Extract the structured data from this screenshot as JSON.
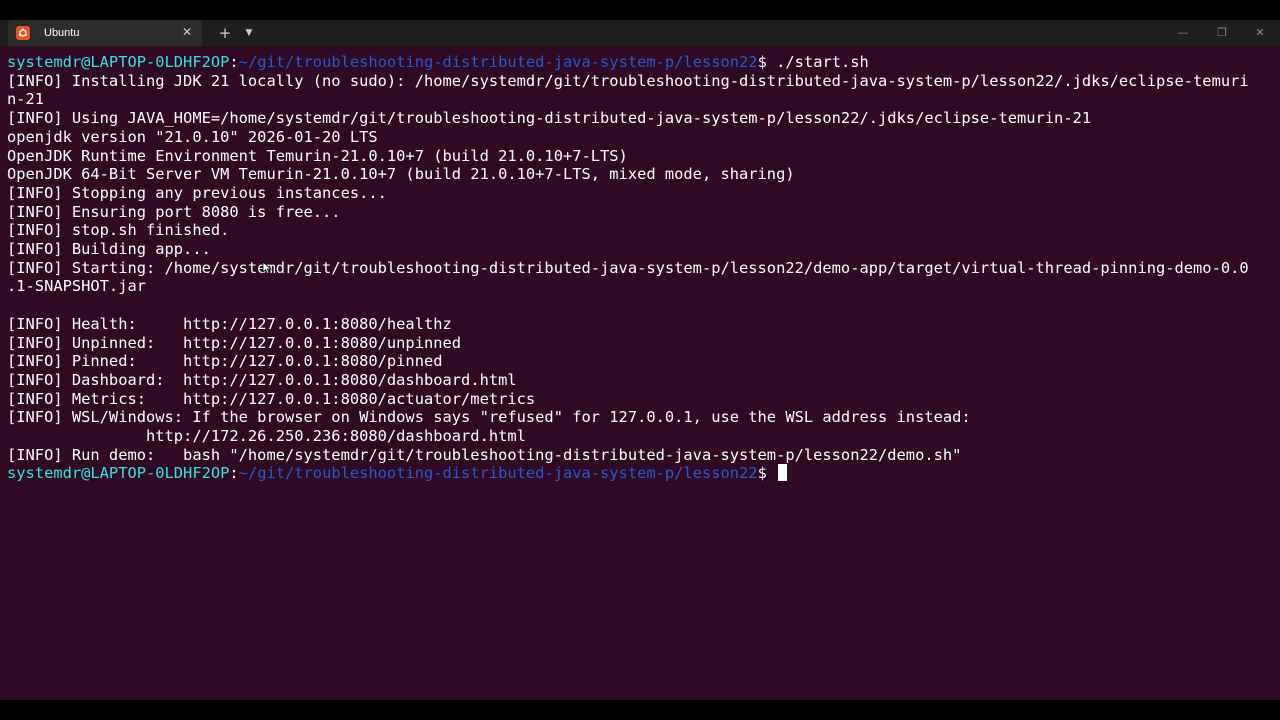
{
  "window": {
    "tab_title": "Ubuntu",
    "tab_icon": "ubuntu-logo-icon",
    "tab_close_glyph": "✕",
    "new_tab_glyph": "+",
    "dropdown_glyph": "▼",
    "minimize_glyph": "—",
    "maximize_glyph": "❐",
    "close_glyph": "✕"
  },
  "colors": {
    "terminal_bg": "#300a24",
    "prompt_user": "#34e2e2",
    "prompt_path": "#2a5ad0",
    "text": "#ffffff"
  },
  "terminal": {
    "prompt1": {
      "user": "systemdr@LAPTOP-0LDHF2OP",
      "sep": ":",
      "path": "~/git/troubleshooting-distributed-java-system-p/lesson22",
      "dollar": "$ ",
      "command": "./start.sh"
    },
    "lines": [
      "[INFO] Installing JDK 21 locally (no sudo): /home/systemdr/git/troubleshooting-distributed-java-system-p/lesson22/.jdks/eclipse-temuri",
      "n-21",
      "[INFO] Using JAVA_HOME=/home/systemdr/git/troubleshooting-distributed-java-system-p/lesson22/.jdks/eclipse-temurin-21",
      "openjdk version \"21.0.10\" 2026-01-20 LTS",
      "OpenJDK Runtime Environment Temurin-21.0.10+7 (build 21.0.10+7-LTS)",
      "OpenJDK 64-Bit Server VM Temurin-21.0.10+7 (build 21.0.10+7-LTS, mixed mode, sharing)",
      "[INFO] Stopping any previous instances...",
      "[INFO] Ensuring port 8080 is free...",
      "[INFO] stop.sh finished.",
      "[INFO] Building app...",
      "[INFO] Starting: /home/systemdr/git/troubleshooting-distributed-java-system-p/lesson22/demo-app/target/virtual-thread-pinning-demo-0.0",
      ".1-SNAPSHOT.jar",
      "",
      "[INFO] Health:     http://127.0.0.1:8080/healthz",
      "[INFO] Unpinned:   http://127.0.0.1:8080/unpinned",
      "[INFO] Pinned:     http://127.0.0.1:8080/pinned",
      "[INFO] Dashboard:  http://127.0.0.1:8080/dashboard.html",
      "[INFO] Metrics:    http://127.0.0.1:8080/actuator/metrics",
      "[INFO] WSL/Windows: If the browser on Windows says \"refused\" for 127.0.0.1, use the WSL address instead:",
      "               http://172.26.250.236:8080/dashboard.html",
      "[INFO] Run demo:   bash \"/home/systemdr/git/troubleshooting-distributed-java-system-p/lesson22/demo.sh\""
    ],
    "prompt2": {
      "user": "systemdr@LAPTOP-0LDHF2OP",
      "sep": ":",
      "path": "~/git/troubleshooting-distributed-java-system-p/lesson22",
      "dollar": "$ "
    }
  }
}
